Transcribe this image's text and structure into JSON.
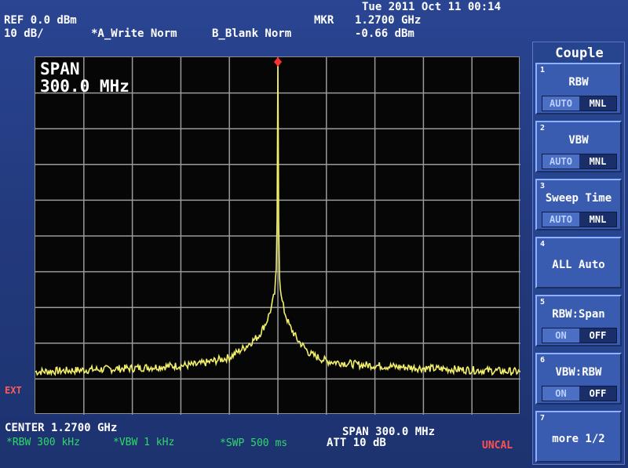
{
  "header": {
    "datetime": "Tue 2011 Oct 11 00:14",
    "ref_level": "REF 0.0 dBm",
    "scale": "10 dB/",
    "trace_a": "*A_Write Norm",
    "trace_b": "B_Blank Norm",
    "marker_label": "MKR",
    "marker_freq": "1.2700 GHz",
    "marker_level": "-0.66 dBm"
  },
  "display": {
    "span_label": "SPAN",
    "span_value": "300.0 MHz",
    "ext_label": "EXT"
  },
  "footer": {
    "center": "CENTER 1.2700 GHz",
    "span": "SPAN 300.0 MHz",
    "rbw": "*RBW 300 kHz",
    "vbw": "*VBW 1 kHz",
    "swp": "*SWP 500 ms",
    "att": "ATT 10 dB",
    "uncal": "UNCAL"
  },
  "menu": {
    "title": "Couple",
    "keys": [
      {
        "num": "1",
        "label": "RBW",
        "opt_a": "AUTO",
        "opt_b": "MNL",
        "selected": "MNL"
      },
      {
        "num": "2",
        "label": "VBW",
        "opt_a": "AUTO",
        "opt_b": "MNL",
        "selected": "MNL"
      },
      {
        "num": "3",
        "label": "Sweep Time",
        "opt_a": "AUTO",
        "opt_b": "MNL",
        "selected": "MNL"
      },
      {
        "num": "4",
        "label": "ALL Auto"
      },
      {
        "num": "5",
        "label": "RBW:Span",
        "opt_a": "ON",
        "opt_b": "OFF",
        "selected": "OFF"
      },
      {
        "num": "6",
        "label": "VBW:RBW",
        "opt_a": "ON",
        "opt_b": "OFF",
        "selected": "OFF"
      },
      {
        "num": "7",
        "label": "more 1/2"
      }
    ]
  },
  "colors": {
    "trace": "#f2ef6a",
    "marker": "#ff3030",
    "grid": "#9a9a9a",
    "background": "#233a7a"
  },
  "chart_data": {
    "type": "line",
    "x_unit": "MHz",
    "y_unit": "dBm",
    "xlim": [
      1120,
      1420
    ],
    "ylim": [
      -100,
      0
    ],
    "grid": true,
    "series": [
      {
        "x": [
          1120,
          1180,
          1220,
          1240,
          1250,
          1258,
          1263,
          1266,
          1268,
          1269,
          1269.5,
          1270,
          1270.5,
          1271,
          1272,
          1274,
          1277,
          1282,
          1290,
          1300,
          1320,
          1360,
          1420
        ],
        "y": [
          -88,
          -87,
          -86,
          -84,
          -81,
          -78,
          -74,
          -70,
          -66,
          -60,
          -45,
          -0.66,
          -45,
          -61,
          -67,
          -71,
          -75,
          -79,
          -83,
          -85,
          -86,
          -87,
          -88
        ]
      }
    ],
    "marker": {
      "x": 1270,
      "y": -0.66
    }
  }
}
